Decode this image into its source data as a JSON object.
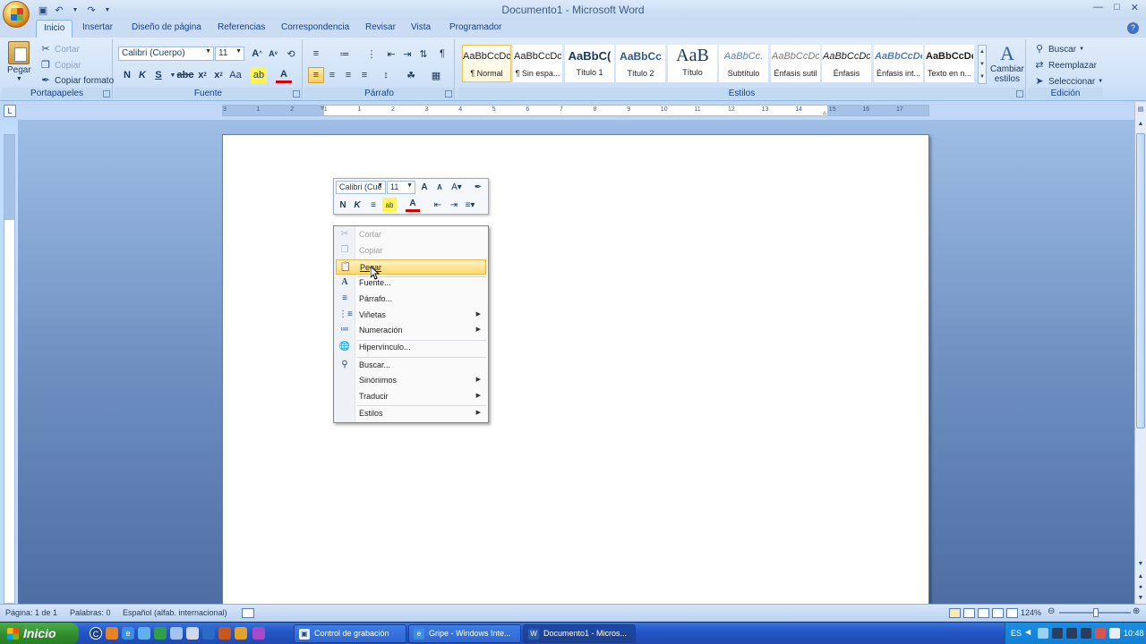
{
  "window": {
    "title": "Documento1 - Microsoft Word"
  },
  "tabs": [
    "Inicio",
    "Insertar",
    "Diseño de página",
    "Referencias",
    "Correspondencia",
    "Revisar",
    "Vista",
    "Programador"
  ],
  "ribbon": {
    "clipboard": {
      "label": "Portapapeles",
      "paste": "Pegar",
      "cut": "Cortar",
      "copy": "Copiar",
      "format_painter": "Copiar formato"
    },
    "font": {
      "label": "Fuente",
      "font_name": "Calibri (Cuerpo)",
      "font_size": "11"
    },
    "paragraph": {
      "label": "Párrafo"
    },
    "styles": {
      "label": "Estilos",
      "items": [
        {
          "sample": "AaBbCcDc",
          "name": "¶ Normal"
        },
        {
          "sample": "AaBbCcDc",
          "name": "¶ Sin espa..."
        },
        {
          "sample": "AaBbC(",
          "name": "Título 1"
        },
        {
          "sample": "AaBbCc",
          "name": "Título 2"
        },
        {
          "sample": "AaB",
          "name": "Título"
        },
        {
          "sample": "AaBbCc.",
          "name": "Subtítulo"
        },
        {
          "sample": "AaBbCcDc",
          "name": "Énfasis sutil"
        },
        {
          "sample": "AaBbCcDc",
          "name": "Énfasis"
        },
        {
          "sample": "AaBbCcDc",
          "name": "Énfasis int..."
        },
        {
          "sample": "AaBbCcDc",
          "name": "Texto en n..."
        }
      ],
      "change_styles_line1": "Cambiar",
      "change_styles_line2": "estilos"
    },
    "editing": {
      "label": "Edición",
      "find": "Buscar",
      "replace": "Reemplazar",
      "select": "Seleccionar"
    }
  },
  "mini_toolbar": {
    "font_name": "Calibri (Cue",
    "font_size": "11"
  },
  "context_menu": {
    "items": [
      {
        "label": "Cortar",
        "icon": "scissors-icon",
        "disabled": true
      },
      {
        "label": "Copiar",
        "icon": "copy-icon",
        "disabled": true
      },
      {
        "label": "Pegar",
        "icon": "paste-icon",
        "highlighted": true
      },
      {
        "label": "Fuente...",
        "icon": "font-icon"
      },
      {
        "label": "Párrafo...",
        "icon": "paragraph-icon"
      },
      {
        "label": "Viñetas",
        "icon": "bullets-icon",
        "submenu": true
      },
      {
        "label": "Numeración",
        "icon": "numbering-icon",
        "submenu": true
      },
      {
        "label": "Hipervínculo...",
        "icon": "hyperlink-icon"
      },
      {
        "label": "Buscar...",
        "icon": "search-icon"
      },
      {
        "label": "Sinónimos",
        "icon": "",
        "submenu": true
      },
      {
        "label": "Traducir",
        "icon": "",
        "submenu": true
      },
      {
        "label": "Estilos",
        "icon": "",
        "submenu": true
      }
    ]
  },
  "ruler": {
    "labels": [
      "3",
      "1",
      "2",
      "1",
      "1",
      "2",
      "3",
      "4",
      "5",
      "6",
      "7",
      "8",
      "9",
      "10",
      "11",
      "12",
      "13",
      "14",
      "15",
      "16",
      "17"
    ]
  },
  "status": {
    "page": "Página: 1 de 1",
    "words": "Palabras: 0",
    "language": "Español (alfab. internacional)",
    "zoom": "124%"
  },
  "taskbar": {
    "start": "Inicio",
    "tasks": [
      {
        "label": "Control de grabación"
      },
      {
        "label": "Gripe - Windows Inte..."
      },
      {
        "label": "Documento1 - Micros...",
        "active": true
      }
    ],
    "lang": "ES",
    "clock": "10:48"
  },
  "colors": {
    "ribbon_bg": "#dfecfb",
    "highlight": "#ffd96b",
    "taskbar": "#2557c7",
    "start": "#2f8a2b"
  }
}
